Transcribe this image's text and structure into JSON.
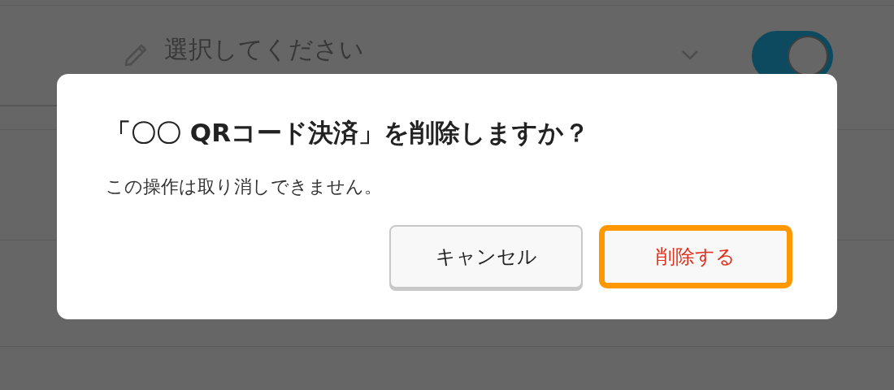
{
  "select_field": {
    "placeholder": "選択してください"
  },
  "toggle": {
    "on": true
  },
  "dialog": {
    "title": "「〇〇 QRコード決済」を削除しますか？",
    "message": "この操作は取り消しできません。",
    "buttons": [
      {
        "label": "キャンセル",
        "kind": "secondary",
        "focused": false
      },
      {
        "label": "削除する",
        "kind": "destructive",
        "focused": true
      }
    ]
  }
}
